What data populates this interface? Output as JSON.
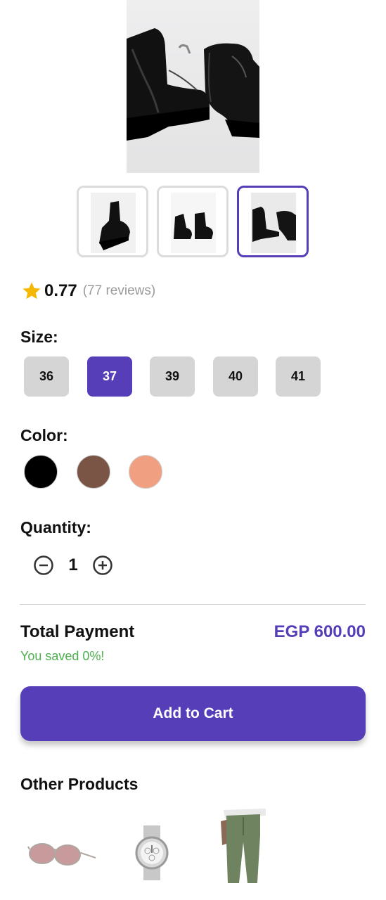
{
  "product": {
    "main_image": "black-chelsea-rain-boots",
    "thumbnails": [
      {
        "name": "boot-side-view",
        "selected": false
      },
      {
        "name": "boots-front-pair",
        "selected": false
      },
      {
        "name": "boots-angled-pair",
        "selected": true
      }
    ]
  },
  "rating": {
    "icon": "star-icon",
    "value": "0.77",
    "reviews": "(77 reviews)"
  },
  "size": {
    "label": "Size:",
    "options": [
      "36",
      "37",
      "39",
      "40",
      "41"
    ],
    "selected": "37"
  },
  "color": {
    "label": "Color:",
    "options": [
      "#000000",
      "#7a5546",
      "#f0a080"
    ]
  },
  "quantity": {
    "label": "Quantity:",
    "value": "1",
    "decrement_icon": "minus-circle-icon",
    "increment_icon": "plus-circle-icon"
  },
  "total": {
    "label": "Total Payment",
    "amount": "EGP 600.00",
    "saved": "You saved 0%!"
  },
  "cart_button": {
    "label": "Add to Cart"
  },
  "other_products": {
    "title": "Other Products",
    "items": [
      "sunglasses",
      "silver-watch",
      "olive-cargo-pants"
    ]
  },
  "colors": {
    "accent": "#563eb8",
    "chip_bg": "#d5d5d5",
    "saved_text": "#4caf50",
    "star": "#f5b800"
  }
}
